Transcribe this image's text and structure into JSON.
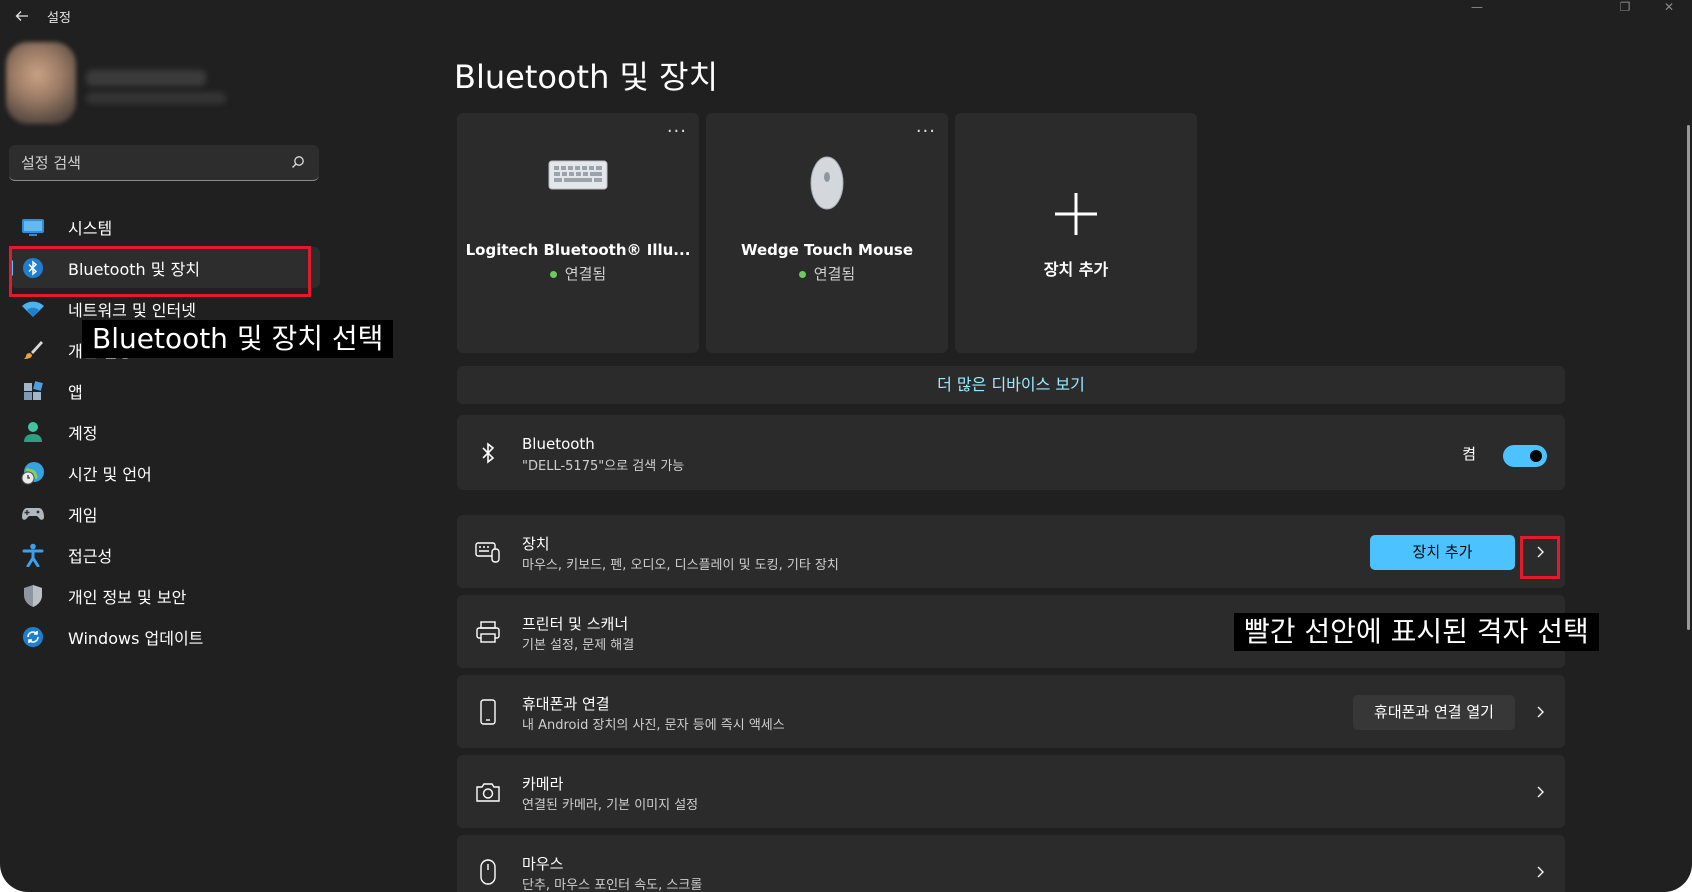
{
  "window": {
    "title": "설정",
    "controls": {
      "minimize": "—",
      "restore": "❐",
      "close": "✕"
    }
  },
  "search": {
    "placeholder": "설정 검색"
  },
  "sidebar": {
    "items": [
      {
        "label": "시스템",
        "icon": "monitor-icon"
      },
      {
        "label": "Bluetooth 및 장치",
        "icon": "bluetooth-icon",
        "active": true
      },
      {
        "label": "네트워크 및 인터넷",
        "icon": "wifi-icon"
      },
      {
        "label": "개인 설정",
        "icon": "brush-icon"
      },
      {
        "label": "앱",
        "icon": "apps-icon"
      },
      {
        "label": "계정",
        "icon": "person-icon"
      },
      {
        "label": "시간 및 언어",
        "icon": "globe-clock-icon"
      },
      {
        "label": "게임",
        "icon": "gamepad-icon"
      },
      {
        "label": "접근성",
        "icon": "accessibility-icon"
      },
      {
        "label": "개인 정보 및 보안",
        "icon": "shield-icon"
      },
      {
        "label": "Windows 업데이트",
        "icon": "update-icon"
      }
    ]
  },
  "main": {
    "title": "Bluetooth 및 장치",
    "devices": [
      {
        "name": "Logitech Bluetooth® Illu...",
        "status": "연결됨",
        "more": "···",
        "icon": "keyboard-icon"
      },
      {
        "name": "Wedge Touch Mouse",
        "status": "연결됨",
        "more": "···",
        "icon": "mouse-device-icon"
      }
    ],
    "add_device_card": {
      "label": "장치 추가"
    },
    "more_devices_link": "더 많은 디바이스 보기",
    "bluetooth_row": {
      "title": "Bluetooth",
      "subtitle": "\"DELL-5175\"으로 검색 가능",
      "toggle_label": "켬",
      "toggle_on": true
    },
    "rows": [
      {
        "title": "장치",
        "subtitle": "마우스, 키보드, 펜, 오디오, 디스플레이 및 도킹, 기타 장치",
        "button": "장치 추가",
        "icon": "devices-icon"
      },
      {
        "title": "프린터 및 스캐너",
        "subtitle": "기본 설정, 문제 해결",
        "icon": "printer-icon"
      },
      {
        "title": "휴대폰과 연결",
        "subtitle": "내 Android 장치의 사진, 문자 등에 즉시 액세스",
        "button": "휴대폰과 연결 열기",
        "icon": "phone-icon"
      },
      {
        "title": "카메라",
        "subtitle": "연결된 카메라, 기본 이미지 설정",
        "icon": "camera-icon"
      },
      {
        "title": "마우스",
        "subtitle": "단추, 마우스 포인터 속도, 스크롤",
        "icon": "mouse-icon"
      }
    ]
  },
  "annotations": {
    "caption_sidebar": "Bluetooth 및 장치 선택",
    "caption_grid": "빨간 선안에 표시된 격자 선택",
    "highlight_color": "#e11b2b"
  },
  "colors": {
    "accent": "#4cc2ff",
    "background": "#202020",
    "card": "#2b2b2b",
    "link": "#99ebff"
  }
}
